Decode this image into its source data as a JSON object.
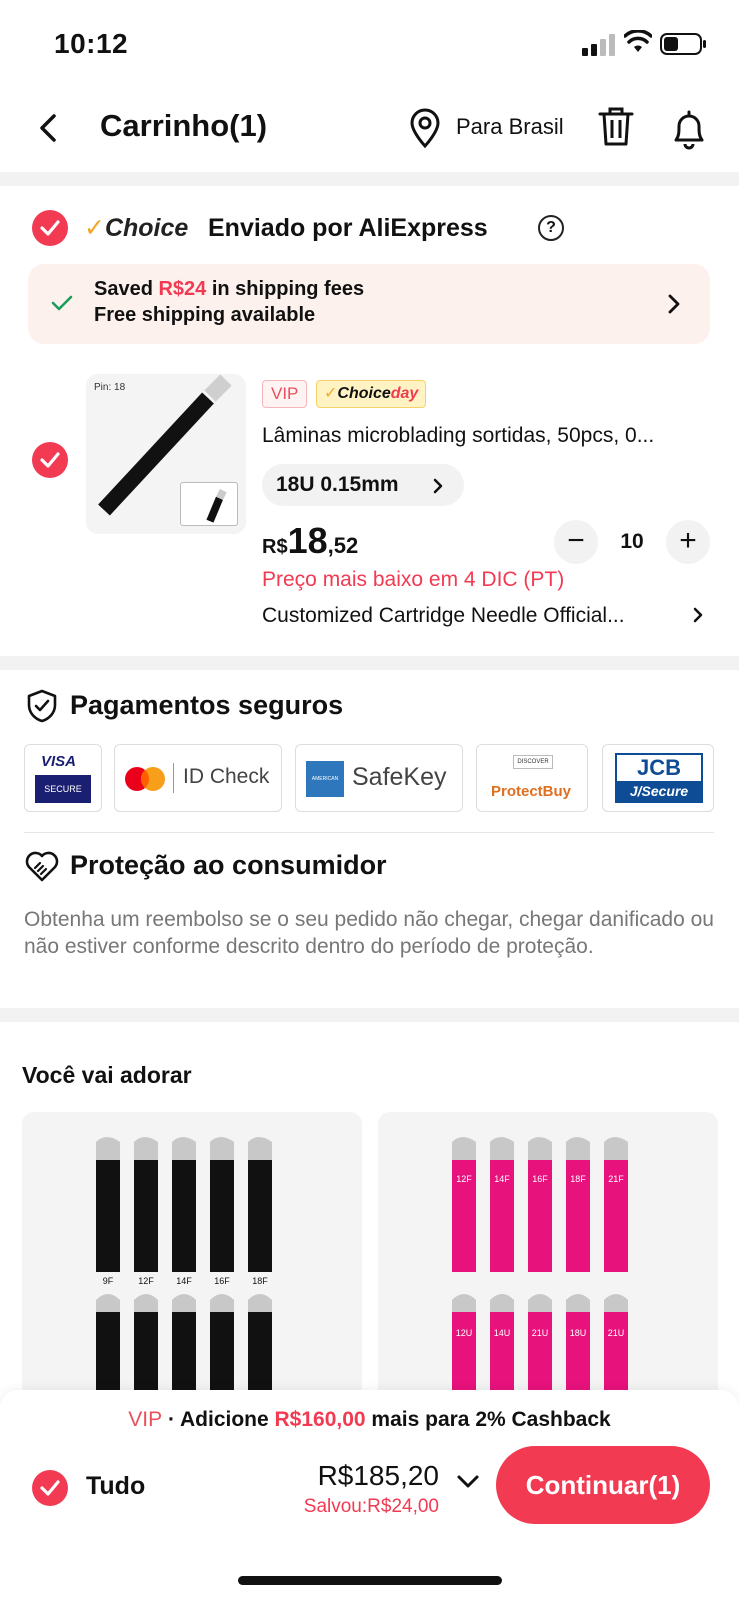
{
  "status_bar": {
    "time": "10:12"
  },
  "header": {
    "title": "Carrinho(1)",
    "location": "Para Brasil"
  },
  "store": {
    "choice_logo": "Choice",
    "name": "Enviado por AliExpress",
    "help": "?"
  },
  "shipping": {
    "saved_prefix": "Saved ",
    "saved_amount": "R$24",
    "saved_suffix": " in shipping fees",
    "free": "Free shipping available"
  },
  "product": {
    "image_label": "Pin: 18",
    "vip": "VIP",
    "choiceday_a": "Choice",
    "choiceday_b": "day",
    "title": "Lâminas microblading sortidas, 50pcs, 0...",
    "variant": "18U 0.15mm",
    "price_currency": "R$",
    "price_int": "18",
    "price_dec": ",52",
    "quantity": "10",
    "lowest_price": "Preço mais baixo em 4 DIC (PT)",
    "seller": "Customized Cartridge Needle Official..."
  },
  "payments": {
    "title": "Pagamentos seguros",
    "visa_top": "VISA",
    "visa_bottom": "SECURE",
    "mc_label": "ID Check",
    "amex_label": "SafeKey",
    "amex_small": "AMERICAN EXPRESS",
    "discover_small": "DISCOVER",
    "discover_label": "ProtectBuy",
    "jcb_top": "JCB",
    "jcb_bottom": "J/Secure"
  },
  "protection": {
    "title": "Proteção ao consumidor",
    "text": "Obtenha um reembolso se o seu pedido não chegar, chegar danificado ou não estiver conforme descrito dentro do período de proteção."
  },
  "recommend": {
    "title": "Você vai adorar",
    "left_labels_top": [
      "9F",
      "12F",
      "14F",
      "16F",
      "18F"
    ],
    "right_labels_top": [
      "12F",
      "14F",
      "16F",
      "18F",
      "21F"
    ],
    "right_labels_bottom": [
      "12U",
      "14U",
      "21U",
      "18U",
      "21U"
    ]
  },
  "bottom": {
    "vip": "VIP",
    "cashback_a": " · Adicione ",
    "cashback_amount": "R$160,00",
    "cashback_b": " mais para 2% Cashback",
    "all_label": "Tudo",
    "total": "R$185,20",
    "saved": "Salvou:R$24,00",
    "checkout": "Continuar(1)"
  },
  "colors": {
    "accent": "#f23a52",
    "choice_yellow": "#f5a623",
    "banner_bg": "#fdf1ee",
    "magenta_blade": "#e8127c"
  }
}
